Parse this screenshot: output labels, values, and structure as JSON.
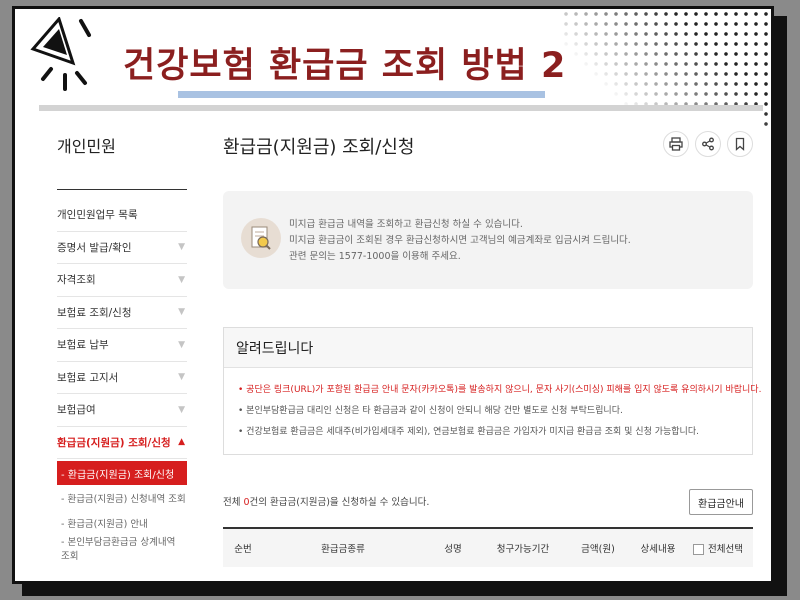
{
  "header": {
    "title": "건강보험 환급금 조회 방법 2"
  },
  "sidebar": {
    "title": "개인민원",
    "items": [
      {
        "label": "개인민원업무 목록",
        "arrow": ""
      },
      {
        "label": "증명서 발급/확인",
        "arrow": "▼"
      },
      {
        "label": "자격조회",
        "arrow": "▼"
      },
      {
        "label": "보험료 조회/신청",
        "arrow": "▼"
      },
      {
        "label": "보험료 납부",
        "arrow": "▼"
      },
      {
        "label": "보험료 고지서",
        "arrow": "▼"
      },
      {
        "label": "보험급여",
        "arrow": "▼"
      },
      {
        "label": "환급금(지원금) 조회/신청",
        "arrow": "▲"
      }
    ],
    "sub_items": [
      "- 환급금(지원금) 조회/신청",
      "- 환급금(지원금) 신청내역 조회",
      "- 환급금(지원금) 안내",
      "- 본인부담금환급금 상계내역 조회"
    ]
  },
  "main": {
    "title": "환급금(지원금) 조회/신청",
    "tools": [
      "printer-icon",
      "share-icon",
      "bookmark-icon"
    ],
    "info_lines": [
      "미지급 환급금 내역을 조회하고 환급신청 하실 수 있습니다.",
      "미지급 환급금이 조회된 경우 환급신청하시면 고객님의 예금계좌로 입금시켜 드립니다.",
      "관련 문의는 1577-1000을 이용해 주세요."
    ],
    "notice": {
      "title": "알려드립니다",
      "lines": [
        "• 공단은 링크(URL)가 포함된 환급금 안내 문자(카카오톡)를 발송하지 않으니, 문자 사기(스미싱) 피해를 입지 않도록 유의하시기 바랍니다.",
        "• 본인부담환급금 대리인 신청은 타 환급금과 같이 신청이 안되니 해당 건만 별도로 신청 부탁드립니다.",
        "• 건강보험료 환급금은 세대주(비가입세대주 제외), 연금보험료 환급금은 가입자가 미지급 환급금 조회 및 신청 가능합니다."
      ]
    },
    "count_prefix": "전체 ",
    "count_value": "0",
    "count_suffix": "건의 환급금(지원금)을 신청하실 수 있습니다.",
    "guide_button": "환급금안내",
    "table_headers": [
      "순번",
      "환급금종류",
      "성명",
      "청구가능기간",
      "금액(원)",
      "상세내용",
      "전체선택"
    ]
  },
  "colors": {
    "title": "#8b1f1f",
    "accent": "#d61e1e",
    "title_bar": "#a9c2e2"
  }
}
